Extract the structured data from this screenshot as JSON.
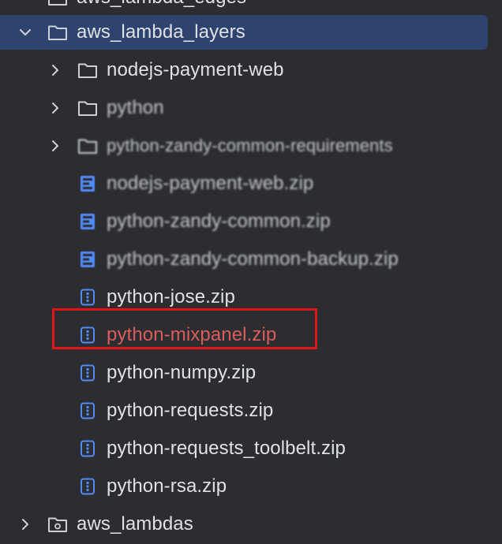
{
  "project_tree": {
    "items": [
      {
        "label": "aws_lambda_edges",
        "kind": "folder",
        "chevron": "none",
        "blurred": false
      },
      {
        "label": "aws_lambda_layers",
        "kind": "folder",
        "chevron": "down",
        "selected": true,
        "blurred": false
      },
      {
        "label": "nodejs-payment-web",
        "kind": "folder",
        "chevron": "right",
        "blurred": false
      },
      {
        "label": "python",
        "kind": "folder",
        "chevron": "right",
        "blurred": true
      },
      {
        "label": "python-zandy-common-requirements",
        "kind": "folder",
        "chevron": "right",
        "blurred": true
      },
      {
        "label": "nodejs-payment-web.zip",
        "kind": "zip-file",
        "blurred": true
      },
      {
        "label": "python-zandy-common.zip",
        "kind": "zip-file",
        "blurred": true
      },
      {
        "label": "python-zandy-common-backup.zip",
        "kind": "zip-file",
        "blurred": true
      },
      {
        "label": "python-jose.zip",
        "kind": "archive",
        "blurred": false
      },
      {
        "label": "python-mixpanel.zip",
        "kind": "archive",
        "status": "error",
        "highlighted": true,
        "blurred": false
      },
      {
        "label": "python-numpy.zip",
        "kind": "archive",
        "blurred": false
      },
      {
        "label": "python-requests.zip",
        "kind": "archive",
        "blurred": false
      },
      {
        "label": "python-requests_toolbelt.zip",
        "kind": "archive",
        "blurred": false
      },
      {
        "label": "python-rsa.zip",
        "kind": "archive",
        "blurred": false
      },
      {
        "label": "aws_lambdas",
        "kind": "package-folder",
        "chevron": "right",
        "blurred": false
      }
    ]
  },
  "colors": {
    "background": "#2b2d30",
    "selection": "#2e436e",
    "text": "#dfe1e5",
    "error_text": "#db5c5c",
    "archive_icon": "#548af7",
    "highlight_border": "#e0161b"
  },
  "icons": {
    "chevron_right": "chevron-right-icon",
    "chevron_down": "chevron-down-icon",
    "folder": "folder-icon",
    "archive": "archive-icon",
    "zip_file": "zip-file-icon",
    "package_folder": "package-folder-icon"
  }
}
